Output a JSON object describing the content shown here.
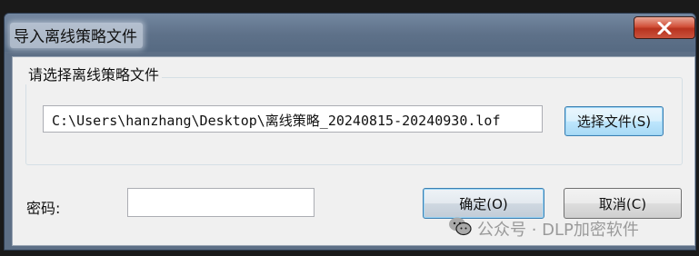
{
  "window": {
    "title": "导入离线策略文件",
    "close_icon": "close-icon"
  },
  "group": {
    "title": "请选择离线策略文件",
    "file_path": "C:\\Users\\hanzhang\\Desktop\\离线策略_20240815-20240930.lof",
    "choose_button": "选择文件(S)"
  },
  "password": {
    "label": "密码:",
    "value": ""
  },
  "buttons": {
    "ok": "确定(O)",
    "cancel": "取消(C)"
  },
  "watermark": {
    "text": "公众号 · DLP加密软件",
    "icon": "wechat-icon"
  },
  "colors": {
    "title_bar": "#5e7189",
    "dialog_bg": "#f0f0f0",
    "close_button": "#c9442f",
    "focus_border": "#3c7fb1"
  }
}
